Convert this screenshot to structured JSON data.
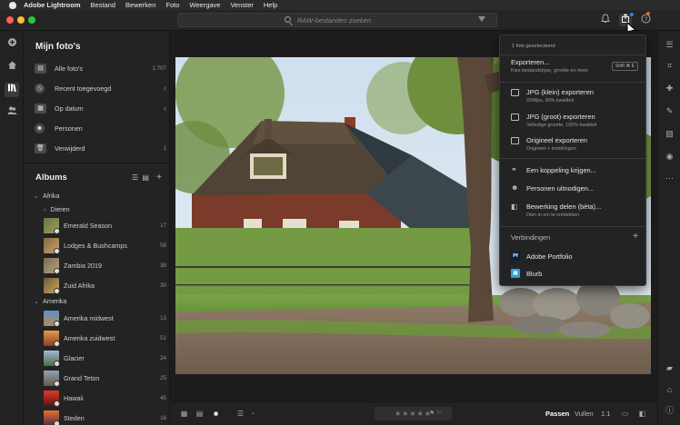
{
  "menubar": {
    "app_name": "Adobe Lightroom",
    "items": [
      "Bestand",
      "Bewerken",
      "Foto",
      "Weergave",
      "Venster",
      "Help"
    ]
  },
  "toolbar": {
    "search_placeholder": "RAW-bestanden zoeken",
    "icons": [
      "bell-icon",
      "share-icon",
      "help-icon"
    ]
  },
  "left_panel": {
    "title": "Mijn foto's",
    "items": [
      {
        "label": "Alle foto's",
        "count": "1.707",
        "icon": "photos-icon"
      },
      {
        "label": "Recent toegevoegd",
        "count": "‹",
        "icon": "clock-icon"
      },
      {
        "label": "Op datum",
        "count": "‹",
        "icon": "calendar-icon"
      },
      {
        "label": "Personen",
        "count": "",
        "icon": "people-icon"
      },
      {
        "label": "Verwijderd",
        "count": "1",
        "icon": "trash-icon"
      }
    ],
    "albums_title": "Albums",
    "groups": [
      {
        "label": "Afrika"
      },
      {
        "label": "Dieren"
      },
      {
        "label": "Amerika"
      }
    ],
    "albums": [
      {
        "label": "Emerald Season",
        "count": "17"
      },
      {
        "label": "Lodges & Bushcamps",
        "count": "58"
      },
      {
        "label": "Zambia 2019",
        "count": "38"
      },
      {
        "label": "Zuid Afrika",
        "count": "30"
      },
      {
        "label": "Amerika midwest",
        "count": "13"
      },
      {
        "label": "Amerika zuidwest",
        "count": "51"
      },
      {
        "label": "Glacier",
        "count": "24"
      },
      {
        "label": "Grand Teton",
        "count": "25"
      },
      {
        "label": "Hawaii",
        "count": "45"
      },
      {
        "label": "Steden",
        "count": "16"
      }
    ]
  },
  "share_menu": {
    "header": "1 foto geselecteerd",
    "export": {
      "title": "Exporteren...",
      "subtitle": "Kies bestandstype, grootte en meer",
      "shortcut": "Shift ⌘ E"
    },
    "export_options": [
      {
        "title": "JPG (klein) exporteren",
        "subtitle": "2048px, 90% kwaliteit"
      },
      {
        "title": "JPG (groot) exporteren",
        "subtitle": "Volledige grootte, 100% kwaliteit"
      },
      {
        "title": "Origineel exporteren",
        "subtitle": "Origineel + instellingen"
      }
    ],
    "share_options": [
      {
        "title": "Een koppeling krijgen..."
      },
      {
        "title": "Personen uitnodigen..."
      },
      {
        "title": "Bewerking delen (bèta)...",
        "subtitle": "Dien in om te ontdekken"
      }
    ],
    "connections_title": "Verbindingen",
    "connections": [
      {
        "label": "Adobe Portfolio",
        "chip": "Pf",
        "color": "#0b1f3a"
      },
      {
        "label": "Blurb",
        "chip": "▤",
        "color": "#2fa0d8"
      }
    ]
  },
  "bottom_bar": {
    "stars": "★★★★★",
    "flags": "⚑ ⚐",
    "fit": "Passen",
    "fill": "Vullen",
    "ratio": "1:1"
  },
  "colors": {
    "accent": "#2680eb",
    "panel": "#232323",
    "background": "#1a1a1a"
  }
}
